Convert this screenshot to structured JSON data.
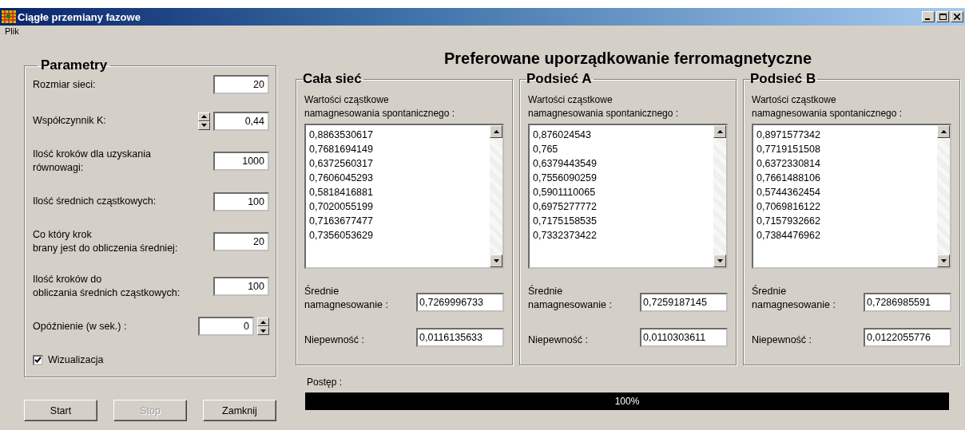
{
  "window": {
    "title": "Ciągłe przemiany fazowe"
  },
  "menu": [
    "Plik"
  ],
  "parameters": {
    "title": "Parametry",
    "fields": [
      {
        "label": "Rozmiar sieci:",
        "value": "20",
        "kind": "text"
      },
      {
        "label": "Współczynnik K:",
        "value": "0,44",
        "kind": "spin_left"
      },
      {
        "label": "Ilość kroków dla uzyskania\nrównowagi:",
        "value": "1000",
        "kind": "text"
      },
      {
        "label": "Ilość średnich cząstkowych:",
        "value": "100",
        "kind": "text"
      },
      {
        "label": "Co który krok\nbrany jest do obliczenia średniej:",
        "value": "20",
        "kind": "text"
      },
      {
        "label": "Ilość kroków do\nobliczania średnich cząstkowych:",
        "value": "100",
        "kind": "text"
      },
      {
        "label": "Opóźnienie (w sek.) :",
        "value": "0",
        "kind": "spin_right"
      }
    ],
    "checkbox": {
      "label": "Wizualizacja",
      "checked": true
    }
  },
  "buttons": [
    {
      "label": "Start",
      "disabled": false
    },
    {
      "label": "Stop",
      "disabled": true
    },
    {
      "label": "Zamknij",
      "disabled": false
    }
  ],
  "heading": "Preferowane uporządkowanie ferromagnetyczne",
  "panels": [
    {
      "title": "Cała sieć",
      "list_label": "Wartości cząstkowe\nnamagnesowania spontanicznego :",
      "values": [
        "0,8863530617",
        "0,7681694149",
        "0,6372560317",
        "0,7606045293",
        "0,5818416881",
        "0,7020055199",
        "0,7163677477",
        "0,7356053629"
      ],
      "mean_label": "Średnie\nnamagnesowanie :",
      "mean": "0,7269996733",
      "uncertainty_label": "Niepewność :",
      "uncertainty": "0,0116135633"
    },
    {
      "title": "Podsieć A",
      "list_label": "Wartości cząstkowe\nnamagnesowania spontanicznego :",
      "values": [
        "0,876024543",
        "0,765",
        "0,6379443549",
        "0,7556090259",
        "0,5901110065",
        "0,6975277772",
        "0,7175158535",
        "0,7332373422"
      ],
      "mean_label": "Średnie\nnamagnesowanie :",
      "mean": "0,7259187145",
      "uncertainty_label": "Niepewność :",
      "uncertainty": "0,0110303611"
    },
    {
      "title": "Podsieć B",
      "list_label": "Wartości cząstkowe\nnamagnesowania spontanicznego :",
      "values": [
        "0,8971577342",
        "0,7719151508",
        "0,6372330814",
        "0,7661488106",
        "0,5744362454",
        "0,7069816122",
        "0,7157932662",
        "0,7384476962"
      ],
      "mean_label": "Średnie\nnamagnesowanie :",
      "mean": "0,7286985591",
      "uncertainty_label": "Niepewność :",
      "uncertainty": "0,0122055776"
    }
  ],
  "progress": {
    "label": "Postęp :",
    "level": 1,
    "text": "100%"
  }
}
